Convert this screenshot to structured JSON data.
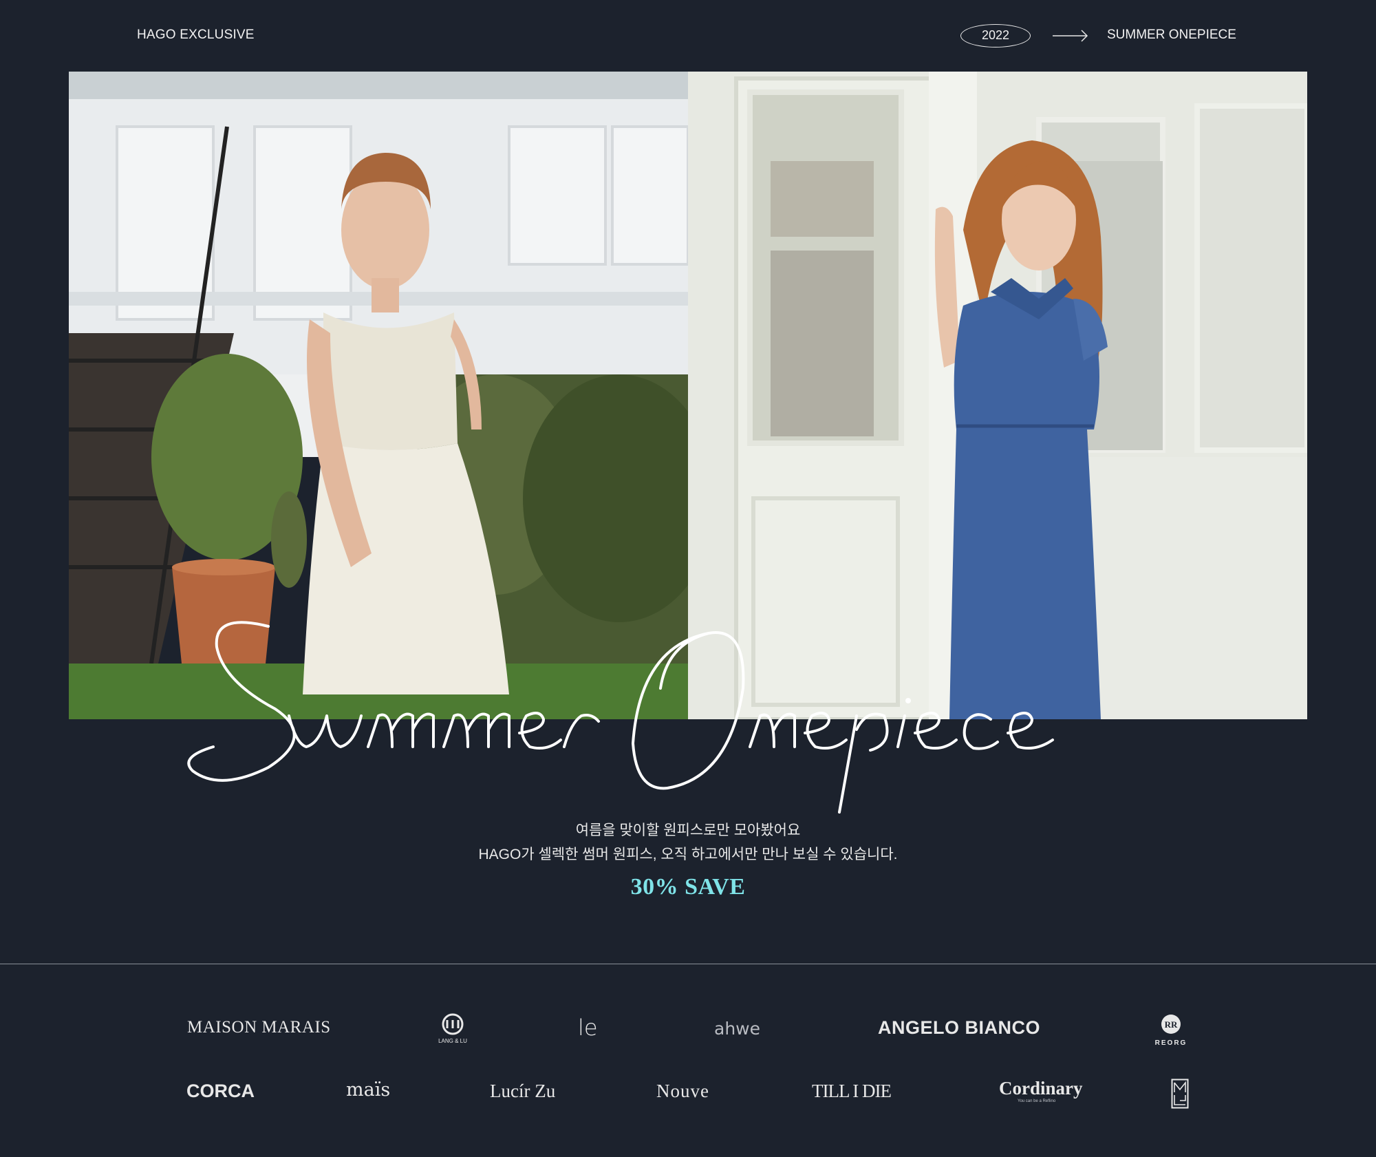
{
  "header": {
    "brand_label": "HAGO EXCLUSIVE",
    "year": "2022",
    "collection_label": "SUMMER ONEPIECE"
  },
  "hero": {
    "script_title": "Summer Onepiece",
    "left_photo": "model-in-white-sleeveless-dress-garden",
    "right_photo": "model-in-blue-denim-shirt-dress-doorway"
  },
  "promo": {
    "line1": "여름을 맞이할 원피스로만 모아봤어요",
    "line2": "HAGO가 셀렉한 썸머 원피스, 오직 하고에서만 만나 보실 수 있습니다.",
    "save": "30% SAVE"
  },
  "brands": {
    "row1": [
      "MAISON MARAIS",
      "LANG & LU",
      "le",
      "ahwe",
      "ANGELO BIANCO",
      "REORG"
    ],
    "row2": [
      "CORCA",
      "maïs",
      "Lucír Zu",
      "Nouve",
      "TILL I DIE",
      "Cordinary",
      "You can be a Reflino",
      "monogram"
    ]
  },
  "colors": {
    "background": "#1c222d",
    "accent": "#7fe3e8",
    "text": "#ffffff"
  }
}
